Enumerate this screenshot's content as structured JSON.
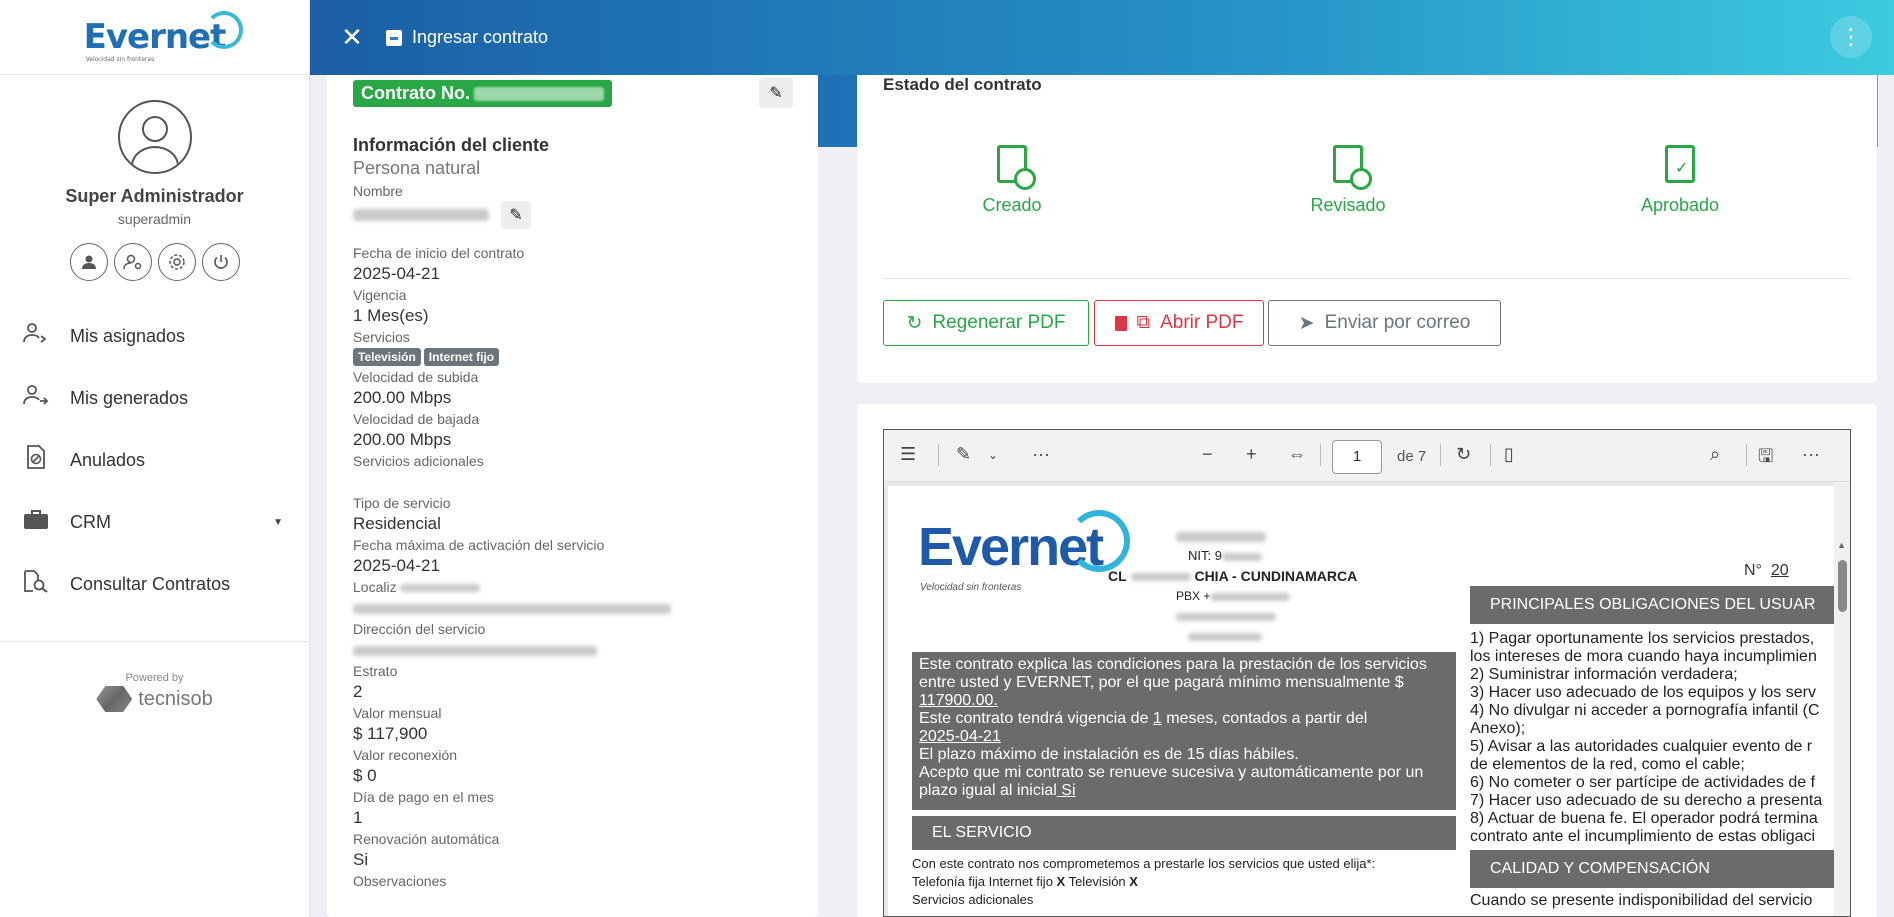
{
  "sidebar": {
    "logo": "Evernet",
    "logo_tagline": "Velocidad sin fronteras",
    "user_name": "Super Administrador",
    "user_role": "superadmin",
    "nav": [
      {
        "label": "Mis asignados",
        "icon": "user-assigned-icon"
      },
      {
        "label": "Mis generados",
        "icon": "user-generated-icon"
      },
      {
        "label": "Anulados",
        "icon": "cancelled-document-icon"
      },
      {
        "label": "CRM",
        "icon": "briefcase-icon"
      },
      {
        "label": "Consultar Contratos",
        "icon": "search-document-icon"
      }
    ],
    "powered_by": "Powered by",
    "powered_brand": "tecnisob"
  },
  "topbar": {
    "title": "Ingresar contrato"
  },
  "contract": {
    "badge": "Contrato No.",
    "section_title": "Información del cliente",
    "person_type": "Persona natural",
    "fields": {
      "nombre_label": "Nombre",
      "fecha_inicio_label": "Fecha de inicio del contrato",
      "fecha_inicio": "2025-04-21",
      "vigencia_label": "Vigencia",
      "vigencia": "1 Mes(es)",
      "servicios_label": "Servicios",
      "servicio_1": "Televisión",
      "servicio_2": "Internet fijo",
      "subida_label": "Velocidad de subida",
      "subida": "200.00 Mbps",
      "bajada_label": "Velocidad de bajada",
      "bajada": "200.00 Mbps",
      "adicionales_label": "Servicios adicionales",
      "tipo_label": "Tipo de servicio",
      "tipo": "Residencial",
      "fecha_max_label": "Fecha máxima de activación del servicio",
      "fecha_max": "2025-04-21",
      "localizacion_label": "Localiz",
      "direccion_label": "Dirección del servicio",
      "estrato_label": "Estrato",
      "estrato": "2",
      "valor_mensual_label": "Valor mensual",
      "valor_mensual": "$ 117,900",
      "valor_reconexion_label": "Valor reconexión",
      "valor_reconexion": "$ 0",
      "dia_pago_label": "Día de pago en el mes",
      "dia_pago": "1",
      "renovacion_label": "Renovación automática",
      "renovacion": "Si",
      "observaciones_label": "Observaciones"
    }
  },
  "estado": {
    "title": "Estado del contrato",
    "states": [
      "Creado",
      "Revisado",
      "Aprobado"
    ],
    "buttons": {
      "regenerar": "Regenerar PDF",
      "abrir": "Abrir PDF",
      "enviar": "Enviar por correo"
    },
    "colors": {
      "green": "#28a745",
      "red": "#dc3545",
      "grey": "#6c757d"
    }
  },
  "pdf": {
    "page": "1",
    "of": "de 7",
    "logo": "Evernet",
    "tagline": "Velocidad sin fronteras",
    "nit": "NIT: 9",
    "address": "CHIA - CUNDINAMARCA",
    "pbx": "PBX +",
    "number_label": "N°",
    "number_visible": "20",
    "intro_lines": [
      "Este contrato explica las condiciones para la prestación de los servicios",
      "entre usted y EVERNET, por el que pagará mínimo mensualmente $",
      "117900.00."
    ],
    "vigencia_line_a": "Este contrato tendrá vigencia de ",
    "vigencia_num": "1",
    "vigencia_line_b": " meses, contados a partir del",
    "vigencia_date": "2025-04-21",
    "plazo_line": "El plazo máximo de instalación es de 15 días hábiles.",
    "acepto_line_1": "Acepto que mi contrato se renueve sucesiva y automáticamente por un",
    "acepto_line_2": "plazo igual al inicial",
    "acepto_si": " Si",
    "servicio_head": "EL SERVICIO",
    "servicio_text": "Con este contrato nos comprometemos a prestarle los servicios que usted elija*:",
    "servicio_opts_a": "Telefonía fija    Internet fijo ",
    "servicio_opts_b": " Televisión ",
    "servicio_mark": "X",
    "servicios_adicionales": "Servicios adicionales",
    "obligaciones_head": "PRINCIPALES OBLIGACIONES DEL USUAR",
    "obligaciones": [
      "1) Pagar oportunamente los servicios prestados,",
      "los intereses de mora cuando haya incumplimien",
      "2) Suministrar información verdadera;",
      "3) Hacer uso adecuado de los equipos y los serv",
      "4) No divulgar ni acceder a pornografía infantil (C",
      "Anexo);",
      "5) Avisar a las autoridades cualquier evento de r",
      "de elementos de la red, como el cable;",
      "6) No cometer o ser partícipe de actividades de f",
      "7) Hacer uso adecuado de su derecho a presenta",
      "8) Actuar de buena fe. El operador podrá termina",
      "contrato ante el incumplimiento de estas obligaci"
    ],
    "calidad_head": "CALIDAD Y COMPENSACIÓN",
    "calidad_text": "Cuando se presente indisponibilidad del servicio"
  }
}
